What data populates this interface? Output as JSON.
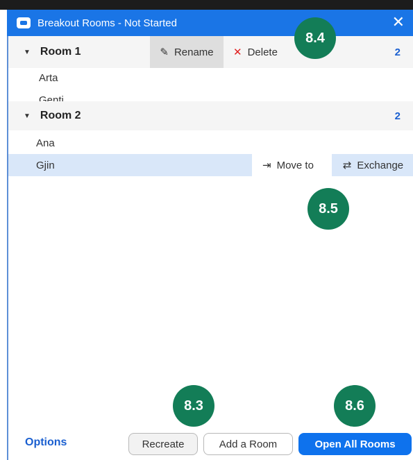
{
  "window": {
    "title": "Breakout Rooms - Not Started",
    "close_icon": "close-icon"
  },
  "rooms": [
    {
      "name": "Room 1",
      "count": "2",
      "participants": [
        "Arta",
        "Genti"
      ],
      "actions": {
        "rename": "Rename",
        "delete": "Delete"
      }
    },
    {
      "name": "Room 2",
      "count": "2",
      "participants": [
        "Ana",
        "Gjin"
      ]
    }
  ],
  "participant_actions": {
    "move_to": "Move to",
    "exchange": "Exchange"
  },
  "footer": {
    "options": "Options",
    "recreate": "Recreate",
    "add_room": "Add a Room",
    "open_all": "Open All Rooms"
  },
  "badges": {
    "b84": "8.4",
    "b85": "8.5",
    "b83": "8.3",
    "b86": "8.6"
  },
  "colors": {
    "titlebar": "#1a75e6",
    "primary_button": "#0e72ed",
    "badge": "#137d57",
    "selection": "#d9e7f9"
  }
}
